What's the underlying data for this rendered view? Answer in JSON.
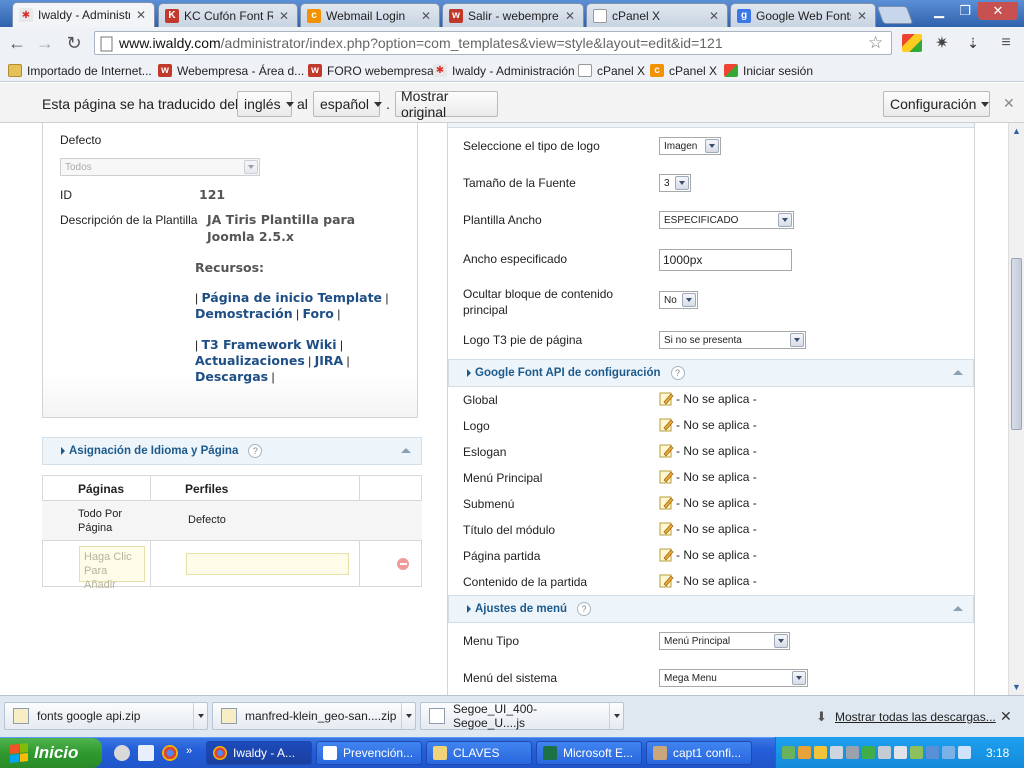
{
  "browser": {
    "tabs": [
      {
        "label": "Iwaldy - Administrac",
        "icon": "joomla-icon",
        "active": true
      },
      {
        "label": "KC Cufón Font Rep",
        "icon": "kc-icon",
        "active": false
      },
      {
        "label": "Webmail Login",
        "icon": "cpanel-icon",
        "active": false
      },
      {
        "label": "Salir - webempresa",
        "icon": "webempresa-icon",
        "active": false
      },
      {
        "label": "cPanel X",
        "icon": "page-icon",
        "active": false
      },
      {
        "label": "Google Web Fonts",
        "icon": "google-icon",
        "active": false
      }
    ],
    "url_host": "www.iwaldy.com",
    "url_path": "/administrator/index.php?option=com_templates&view=style&layout=edit&id=121",
    "bookmarks": [
      {
        "label": "Importado de Internet...",
        "icon": "folder-icon"
      },
      {
        "label": "Webempresa - Área d...",
        "icon": "webempresa-icon"
      },
      {
        "label": "FORO webempresa",
        "icon": "webempresa-icon"
      },
      {
        "label": "Iwaldy - Administración",
        "icon": "joomla-icon"
      },
      {
        "label": "cPanel X",
        "icon": "page-icon"
      },
      {
        "label": "cPanel X",
        "icon": "cpanel-icon"
      },
      {
        "label": "Iniciar sesión",
        "icon": "windows-icon"
      }
    ]
  },
  "translate_bar": {
    "text_prefix": "Esta página se ha traducido del",
    "from_lang": "inglés",
    "connector": "al",
    "to_lang": "español",
    "dot": ".",
    "show_original": "Mostrar original",
    "settings": "Configuración"
  },
  "left": {
    "defecto_label": "Defecto",
    "defecto_select": "Todos",
    "id_label": "ID",
    "id_value": "121",
    "desc_label": "Descripción de la Plantilla",
    "desc_value_line1": "JA Tiris Plantilla para",
    "desc_value_line2": "Joomla 2.5.x",
    "recursos_label": "Recursos:",
    "links": {
      "inicio": "Página de inicio Template",
      "demo": "Demostración",
      "foro": "Foro",
      "wiki": "T3 Framework Wiki",
      "actualizaciones": "Actualizaciones",
      "jira": "JIRA",
      "descargas": "Descargas",
      "pipe": "|"
    },
    "assign_section": "Asignación de Idioma y Página",
    "help": "?",
    "table": {
      "headers": [
        "Páginas",
        "Perfiles"
      ],
      "row": {
        "pages": "Todo Por Página",
        "profile": "Defecto"
      },
      "add_placeholder": "Haga Clic Para Añadir"
    }
  },
  "right": {
    "fields": [
      {
        "label": "Seleccione el tipo de logo",
        "value": "Imagen"
      },
      {
        "label": "Tamaño de la Fuente",
        "value": "3"
      },
      {
        "label": "Plantilla Ancho",
        "value": "ESPECIFICADO"
      },
      {
        "label": "Ancho especificado",
        "value": "1000px"
      },
      {
        "label": "Ocultar bloque de contenido principal",
        "value": "No"
      },
      {
        "label": "Logo T3 pie de página",
        "value": "Si no se presenta"
      }
    ],
    "google_section": "Google Font API de configuración",
    "google_rows": [
      {
        "label": "Global",
        "value": "- No se aplica -"
      },
      {
        "label": "Logo",
        "value": "- No se aplica -"
      },
      {
        "label": "Eslogan",
        "value": "- No se aplica -"
      },
      {
        "label": "Menú Principal",
        "value": "- No se aplica -"
      },
      {
        "label": "Submenú",
        "value": "- No se aplica -"
      },
      {
        "label": "Título del módulo",
        "value": "- No se aplica -"
      },
      {
        "label": "Página partida",
        "value": "- No se aplica -"
      },
      {
        "label": "Contenido de la partida",
        "value": "- No se aplica -"
      }
    ],
    "menu_section": "Ajustes de menú",
    "menu_fields": [
      {
        "label": "Menu Tipo",
        "value": "Menú Principal"
      },
      {
        "label": "Menú del sistema",
        "value": "Mega Menu"
      }
    ]
  },
  "downloads": {
    "items": [
      "fonts google api.zip",
      "manfred-klein_geo-san....zip",
      "Segoe_UI_400-Segoe_U....js"
    ],
    "show_all": "Mostrar todas las descargas..."
  },
  "taskbar": {
    "start": "Inicio",
    "items": [
      "Iwaldy - A...",
      "Prevención...",
      "CLAVES",
      "Microsoft E...",
      "capt1 confi..."
    ],
    "clock": "3:18"
  },
  "colors": {
    "link": "#1d4e85",
    "section_text": "#1d5a8c",
    "start_green": "#2f9a2e"
  }
}
